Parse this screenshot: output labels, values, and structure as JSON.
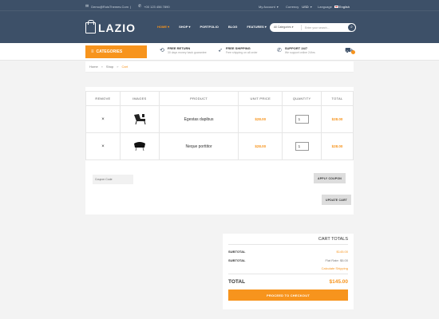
{
  "topbar": {
    "email": "Demo@RoisThemes.Com",
    "phone": "+00 123 456 7890",
    "my_account": "My Account",
    "currency_label": "Currency",
    "currency_value": "USD",
    "language_label": "Language",
    "language_value": "English"
  },
  "logo": {
    "text": "LAZIO"
  },
  "nav": {
    "items": [
      {
        "label": "HOME"
      },
      {
        "label": "SHOP"
      },
      {
        "label": "PORTFOLIO"
      },
      {
        "label": "BLOG"
      },
      {
        "label": "FEATURES"
      }
    ]
  },
  "search": {
    "category": "All Categories",
    "placeholder": "Enter your search..."
  },
  "categories_label": "CATEGORIES",
  "features": [
    {
      "title": "FREE RETURN",
      "subtitle": "30 days money back guarantee"
    },
    {
      "title": "FREE SHIPPING",
      "subtitle": "Free shipping on all order"
    },
    {
      "title": "SUPPORT 24/7",
      "subtitle": "We support online 24hrs"
    }
  ],
  "breadcrumb": {
    "home": "Home",
    "shop": "Shop",
    "current": "Cart"
  },
  "cart_table": {
    "headers": [
      "REMOVE",
      "IMAGES",
      "PRODUCT",
      "UNIT PRICE",
      "QUANTITY",
      "TOTAL"
    ],
    "rows": [
      {
        "remove": "×",
        "product": "Egestas dapibus",
        "unit_price": "$28.00",
        "quantity": "1",
        "total": "$28.00"
      },
      {
        "remove": "×",
        "product": "Neque porttitor",
        "unit_price": "$28.00",
        "quantity": "1",
        "total": "$28.00"
      }
    ]
  },
  "coupon": {
    "placeholder": "Coupon Code",
    "apply_label": "APPLY COUPON",
    "update_label": "UPDATE CART"
  },
  "totals": {
    "title": "CART TOTALS",
    "subtotal_label": "SUBTOTAL",
    "subtotal_value": "$145.00",
    "shipping_label": "SUBTOTAL",
    "shipping_rate": "Flat Rate: $5.00",
    "shipping_link": "Calculate Shipping",
    "total_label": "TOTAL",
    "total_value": "$145.00",
    "checkout_label": "PROCEED TO CHECKOUT"
  },
  "colors": {
    "header": "#3d5068",
    "accent": "#f7941d",
    "background": "#f3f3f3"
  }
}
